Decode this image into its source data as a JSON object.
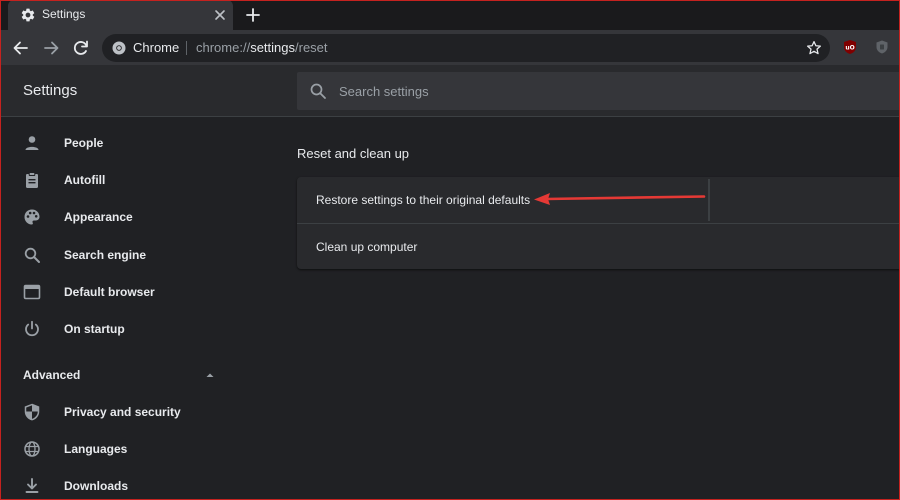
{
  "tab": {
    "title": "Settings"
  },
  "omnibox": {
    "site": "Chrome",
    "url_scheme": "chrome://",
    "url_path": "settings",
    "url_rest": "/reset"
  },
  "extensions": {
    "ublock_label": "uO"
  },
  "header": {
    "title": "Settings",
    "search_placeholder": "Search settings"
  },
  "sidebar": {
    "items": [
      {
        "label": "People",
        "icon": "person-icon"
      },
      {
        "label": "Autofill",
        "icon": "clipboard-icon"
      },
      {
        "label": "Appearance",
        "icon": "palette-icon"
      },
      {
        "label": "Search engine",
        "icon": "search-icon"
      },
      {
        "label": "Default browser",
        "icon": "browser-window-icon"
      },
      {
        "label": "On startup",
        "icon": "power-icon"
      }
    ],
    "advanced_label": "Advanced",
    "advanced_items": [
      {
        "label": "Privacy and security",
        "icon": "shield-icon"
      },
      {
        "label": "Languages",
        "icon": "globe-icon"
      },
      {
        "label": "Downloads",
        "icon": "download-icon"
      }
    ]
  },
  "main": {
    "section_title": "Reset and clean up",
    "rows": [
      {
        "label": "Restore settings to their original defaults"
      },
      {
        "label": "Clean up computer"
      }
    ]
  },
  "colors": {
    "background": "#202124",
    "card": "#292a2d",
    "text": "#e8eaed",
    "muted": "#9aa0a6",
    "annotation_arrow": "#e53935",
    "frame_border": "#c5221f"
  }
}
